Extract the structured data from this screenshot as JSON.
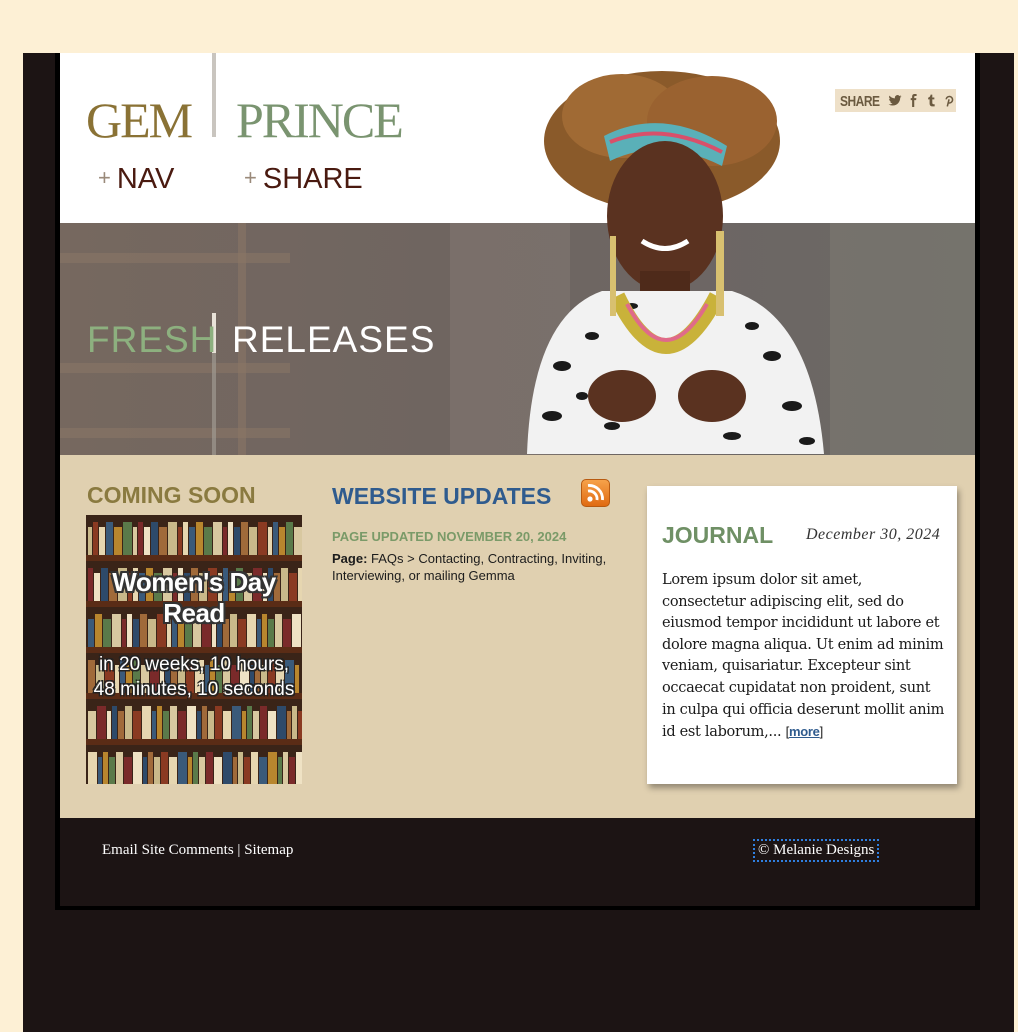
{
  "header": {
    "logo_first": "GEM",
    "logo_second": "PRINCE",
    "nav_label": "NAV",
    "share_label": "SHARE",
    "plus_symbol": "+",
    "share_box_label": "SHARE",
    "share_icons": [
      "twitter-icon",
      "facebook-icon",
      "tumblr-icon",
      "pinterest-icon"
    ]
  },
  "banner": {
    "word_one": "FRESH",
    "word_two": "RELEASES"
  },
  "coming_soon": {
    "title": "COMING SOON",
    "cover_title": "Women's Day Read",
    "countdown": "in 20 weeks, 10 hours, 48 minutes, 10 seconds"
  },
  "updates": {
    "title": "WEBSITE UPDATES",
    "updated": "PAGE UPDATED NOVEMBER 20, 2024",
    "page_label": "Page:",
    "page_text": "FAQs > Contacting, Contracting, Inviting, Interviewing, or mailing Gemma"
  },
  "journal": {
    "title": "JOURNAL",
    "date": "December 30, 2024",
    "body": "Lorem ipsum dolor sit amet, consectetur adipiscing elit, sed do eiusmod tempor incididunt ut labore et dolore magna aliqua. Ut enim ad minim veniam, quisariatur. Excepteur sint occaecat cupidatat non proident, sunt in culpa qui officia deserunt mollit anim id est laborum,...",
    "more_open": "[",
    "more_label": "more",
    "more_close": "]"
  },
  "footer": {
    "email_link": "Email Site Comments",
    "separator": "|",
    "sitemap_link": "Sitemap",
    "copyright": "© Melanie Designs"
  },
  "colors": {
    "page_bg": "#fdf0d5",
    "gold": "#8a7235",
    "sage": "#7a9470",
    "blue": "#2f5b8e",
    "tan": "#e0d0b0",
    "dark": "#1c1414"
  }
}
